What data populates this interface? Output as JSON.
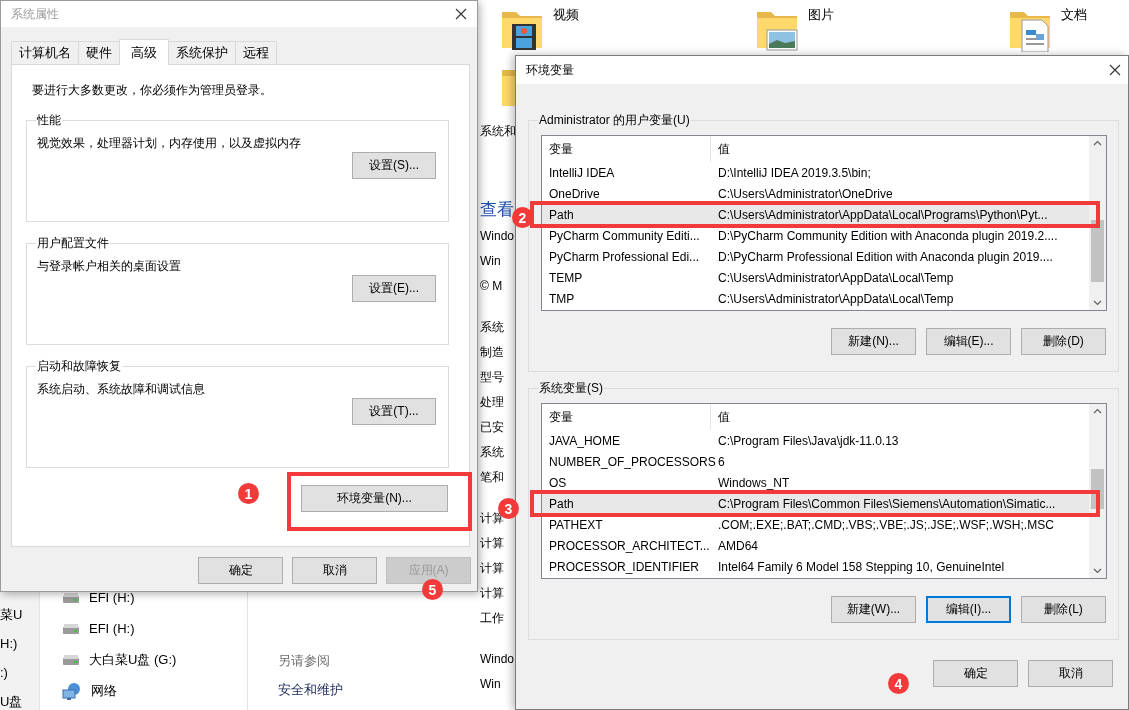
{
  "explorer": {
    "folders": [
      {
        "label": "视频",
        "kind": "video"
      },
      {
        "label": "图片",
        "kind": "pictures"
      },
      {
        "label": "文档",
        "kind": "documents"
      },
      {
        "kind": "plain"
      }
    ],
    "edge_fragments": [
      "菜U",
      "H:)",
      ":)",
      "U盘"
    ],
    "nav_items": [
      {
        "label": "EFI (H:)",
        "kind": "drive"
      },
      {
        "label": "EFI (H:)",
        "kind": "drive"
      },
      {
        "label": "大白菜U盘 (G:)",
        "kind": "drive"
      },
      {
        "label": "网络",
        "kind": "network"
      }
    ],
    "see_also": {
      "title": "另请参阅",
      "links": [
        "安全和维护"
      ]
    },
    "system_column": [
      {
        "text": "系统和",
        "kind": "breadcrumb"
      },
      {
        "text": "查看",
        "kind": "link"
      },
      {
        "text": "Windo",
        "kind": "text"
      },
      {
        "text": "Win",
        "kind": "text"
      },
      {
        "text": "© M",
        "kind": "text"
      },
      {
        "text": "系统",
        "kind": "heading"
      },
      {
        "text": "制造",
        "kind": "text"
      },
      {
        "text": "型号",
        "kind": "text"
      },
      {
        "text": "处理",
        "kind": "text"
      },
      {
        "text": "已安",
        "kind": "text"
      },
      {
        "text": "系统",
        "kind": "text"
      },
      {
        "text": "笔和",
        "kind": "text"
      },
      {
        "text": "计算",
        "kind": "heading"
      },
      {
        "text": "计算",
        "kind": "text"
      },
      {
        "text": "计算",
        "kind": "text"
      },
      {
        "text": "计算",
        "kind": "text"
      },
      {
        "text": "工作",
        "kind": "text"
      },
      {
        "text": "Windo",
        "kind": "heading"
      },
      {
        "text": "Win",
        "kind": "text"
      }
    ]
  },
  "system_properties": {
    "title": "系统属性",
    "active": false,
    "tabs": [
      {
        "label": "计算机名",
        "selected": false
      },
      {
        "label": "硬件",
        "selected": false
      },
      {
        "label": "高级",
        "selected": true
      },
      {
        "label": "系统保护",
        "selected": false
      },
      {
        "label": "远程",
        "selected": false
      }
    ],
    "note": "要进行大多数更改，你必须作为管理员登录。",
    "groups": [
      {
        "title": "性能",
        "description": "视觉效果，处理器计划，内存使用，以及虚拟内存",
        "button": "设置(S)..."
      },
      {
        "title": "用户配置文件",
        "description": "与登录帐户相关的桌面设置",
        "button": "设置(E)..."
      },
      {
        "title": "启动和故障恢复",
        "description": "系统启动、系统故障和调试信息",
        "button": "设置(T)..."
      }
    ],
    "env_button": "环境变量(N)...",
    "buttons": [
      {
        "label": "确定",
        "disabled": false
      },
      {
        "label": "取消",
        "disabled": false
      },
      {
        "label": "应用(A)",
        "disabled": true
      }
    ]
  },
  "environment_variables": {
    "title": "环境变量",
    "active": true,
    "user_vars": {
      "title": "Administrator 的用户变量(U)",
      "columns": [
        "变量",
        "值"
      ],
      "rows": [
        {
          "name": "IntelliJ IDEA",
          "value": "D:\\IntelliJ IDEA 2019.3.5\\bin;",
          "selected": false
        },
        {
          "name": "OneDrive",
          "value": "C:\\Users\\Administrator\\OneDrive",
          "selected": false
        },
        {
          "name": "Path",
          "value": "C:\\Users\\Administrator\\AppData\\Local\\Programs\\Python\\Pyt...",
          "selected": true
        },
        {
          "name": "PyCharm Community Editi...",
          "value": "D:\\PyCharm Community Edition with Anaconda plugin 2019.2....",
          "selected": false
        },
        {
          "name": "PyCharm Professional Edi...",
          "value": "D:\\PyCharm Professional Edition with Anaconda plugin 2019....",
          "selected": false
        },
        {
          "name": "TEMP",
          "value": "C:\\Users\\Administrator\\AppData\\Local\\Temp",
          "selected": false
        },
        {
          "name": "TMP",
          "value": "C:\\Users\\Administrator\\AppData\\Local\\Temp",
          "selected": false
        }
      ],
      "buttons": [
        {
          "label": "新建(N)...",
          "focused": false
        },
        {
          "label": "编辑(E)...",
          "focused": false
        },
        {
          "label": "删除(D)",
          "focused": false
        }
      ]
    },
    "system_vars": {
      "title": "系统变量(S)",
      "columns": [
        "变量",
        "值"
      ],
      "rows": [
        {
          "name": "JAVA_HOME",
          "value": "C:\\Program Files\\Java\\jdk-11.0.13",
          "selected": false
        },
        {
          "name": "NUMBER_OF_PROCESSORS",
          "value": "6",
          "selected": false
        },
        {
          "name": "OS",
          "value": "Windows_NT",
          "selected": false
        },
        {
          "name": "Path",
          "value": "C:\\Program Files\\Common Files\\Siemens\\Automation\\Simatic...",
          "selected": true
        },
        {
          "name": "PATHEXT",
          "value": ".COM;.EXE;.BAT;.CMD;.VBS;.VBE;.JS;.JSE;.WSF;.WSH;.MSC",
          "selected": false
        },
        {
          "name": "PROCESSOR_ARCHITECT...",
          "value": "AMD64",
          "selected": false
        },
        {
          "name": "PROCESSOR_IDENTIFIER",
          "value": "Intel64 Family 6 Model 158 Stepping 10, GenuineIntel",
          "selected": false
        }
      ],
      "buttons": [
        {
          "label": "新建(W)...",
          "focused": false
        },
        {
          "label": "编辑(I)...",
          "focused": true
        },
        {
          "label": "删除(L)",
          "focused": false
        }
      ]
    },
    "buttons": [
      "确定",
      "取消"
    ]
  },
  "annotations": [
    {
      "number": "1",
      "boxed": true
    },
    {
      "number": "2",
      "boxed": true
    },
    {
      "number": "3",
      "boxed": true
    },
    {
      "number": "4",
      "boxed": false
    },
    {
      "number": "5",
      "boxed": false
    }
  ]
}
